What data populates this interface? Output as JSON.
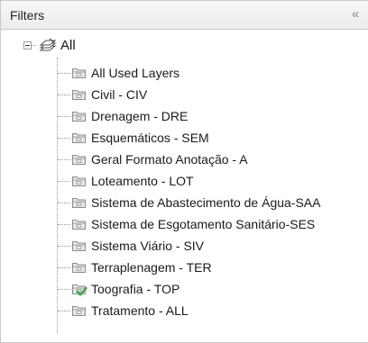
{
  "header": {
    "title": "Filters",
    "collapse_glyph": "«"
  },
  "tree": {
    "root": {
      "label": "All",
      "icon": "layer-stack-icon",
      "expanded": true
    },
    "items": [
      {
        "label": "All Used Layers",
        "icon": "filter-folder-icon",
        "checked": false
      },
      {
        "label": "Civil - CIV",
        "icon": "filter-folder-icon",
        "checked": false
      },
      {
        "label": "Drenagem - DRE",
        "icon": "filter-folder-icon",
        "checked": false
      },
      {
        "label": "Esquemáticos - SEM",
        "icon": "filter-folder-icon",
        "checked": false
      },
      {
        "label": "Geral Formato Anotação - A",
        "icon": "filter-folder-icon",
        "checked": false
      },
      {
        "label": "Loteamento - LOT",
        "icon": "filter-folder-icon",
        "checked": false
      },
      {
        "label": "Sistema de Abastecimento de Água-SAA",
        "icon": "filter-folder-icon",
        "checked": false
      },
      {
        "label": "Sistema de Esgotamento Sanitário-SES",
        "icon": "filter-folder-icon",
        "checked": false
      },
      {
        "label": "Sistema Viário - SIV",
        "icon": "filter-folder-icon",
        "checked": false
      },
      {
        "label": "Terraplenagem - TER",
        "icon": "filter-folder-icon",
        "checked": false
      },
      {
        "label": "Toografia - TOP",
        "icon": "filter-folder-check-icon",
        "checked": true
      },
      {
        "label": "Tratamento - ALL",
        "icon": "filter-folder-icon",
        "checked": false
      }
    ]
  },
  "colors": {
    "check_green": "#3aa835",
    "folder_fill": "#e9e9e9",
    "folder_stroke": "#8c8c8c"
  }
}
